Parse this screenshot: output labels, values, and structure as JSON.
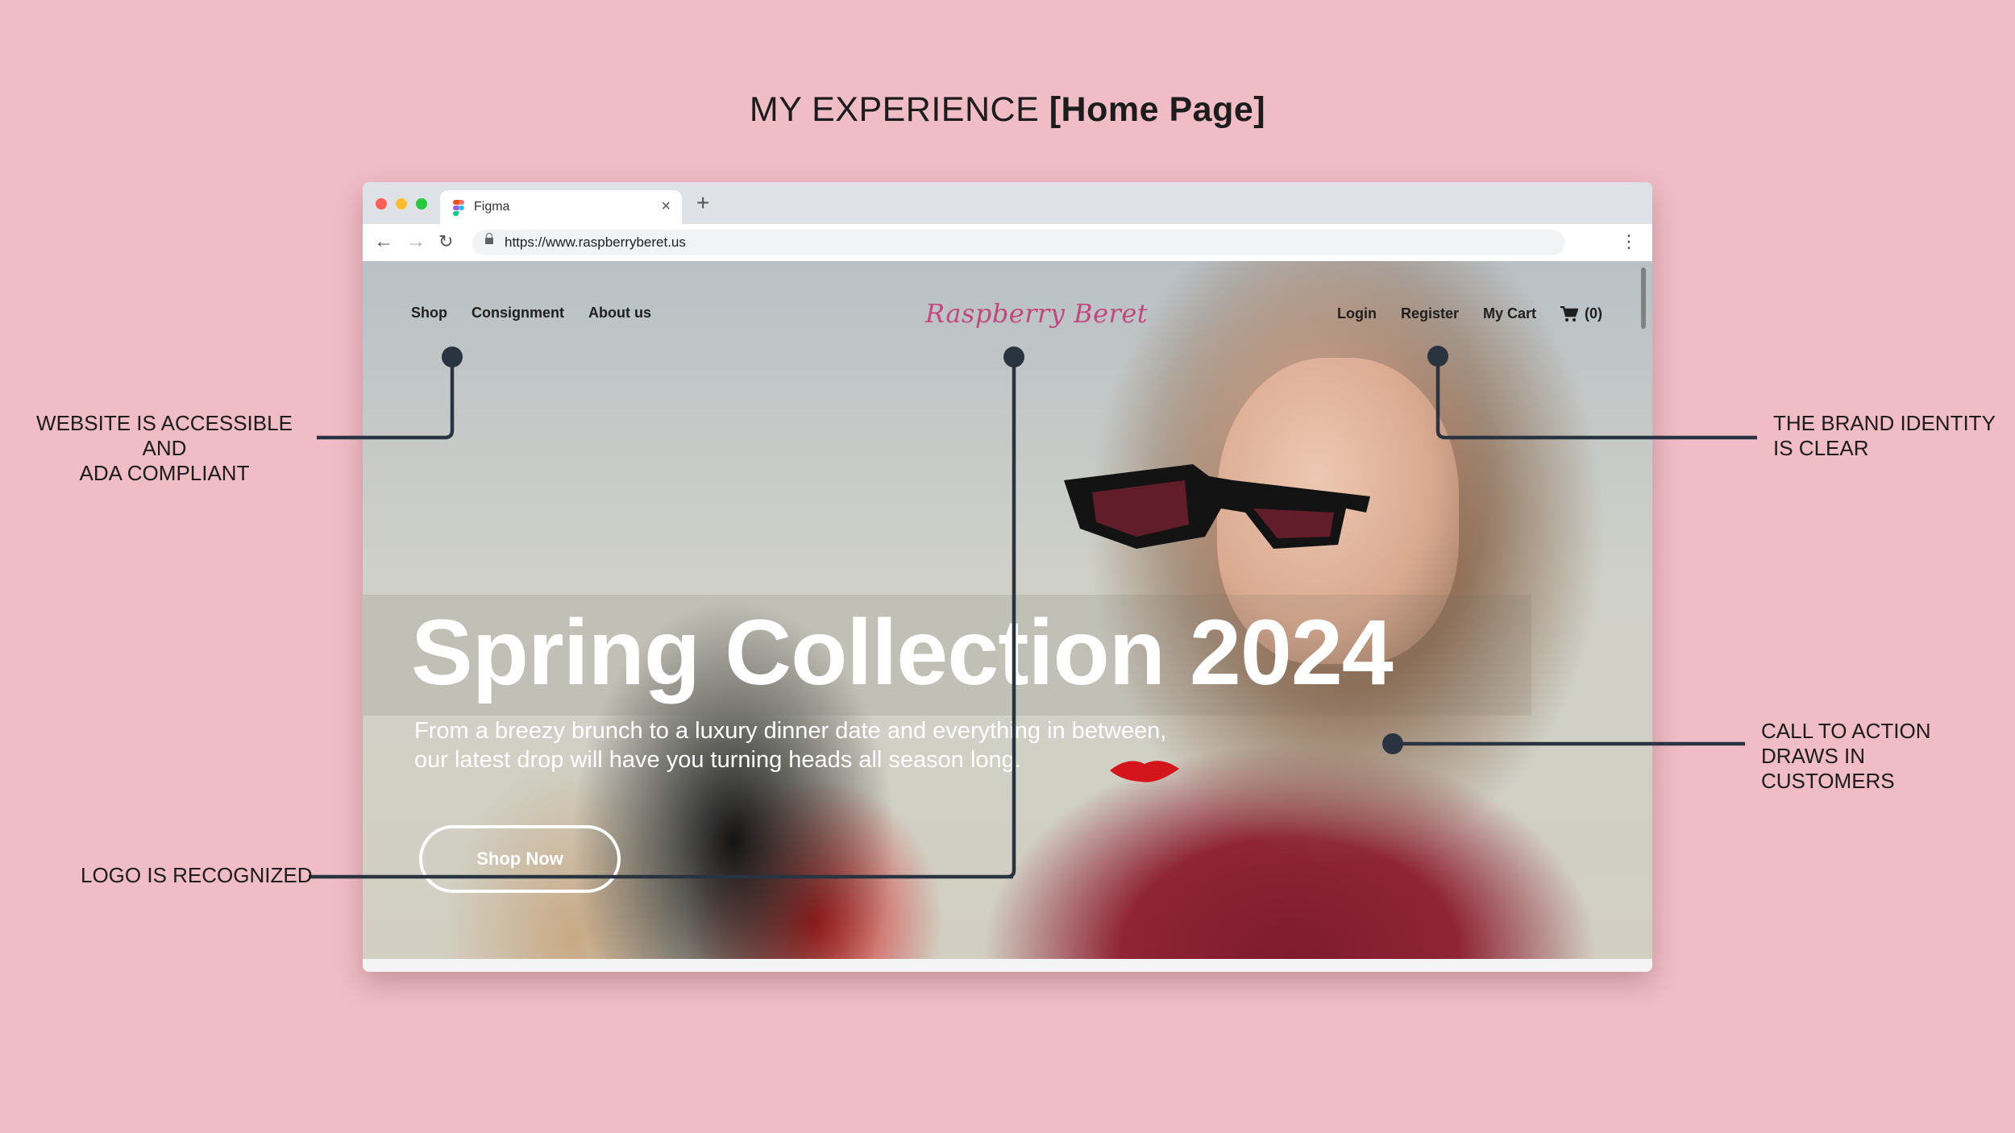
{
  "slide": {
    "title_regular": "MY EXPERIENCE",
    "title_bold": "[Home Page]"
  },
  "browser": {
    "tab_title": "Figma",
    "tab_close": "×",
    "new_tab": "+",
    "url": "https://www.raspberryberet.us",
    "back": "←",
    "forward": "→",
    "reload": "↻",
    "menu": "⋮"
  },
  "site": {
    "nav_left": [
      "Shop",
      "Consignment",
      "About us"
    ],
    "logo": "Raspberry Beret",
    "nav_right": [
      "Login",
      "Register",
      "My Cart"
    ],
    "cart_count": "(0)",
    "hero_title": "Spring Collection 2024",
    "hero_subtitle": "From a breezy brunch to a luxury dinner date and everything in between, our latest drop will have you turning heads all season long.",
    "cta_label": "Shop Now"
  },
  "callouts": {
    "accessible": [
      "WEBSITE IS ACCESSIBLE AND",
      "ADA COMPLIANT"
    ],
    "brand": [
      "THE BRAND IDENTITY",
      "IS CLEAR"
    ],
    "cta": [
      "CALL TO ACTION",
      "DRAWS IN CUSTOMERS"
    ],
    "logo": [
      "LOGO IS RECOGNIZED"
    ]
  },
  "colors": {
    "background": "#f0bcc5",
    "brand_pink": "#c2477f",
    "callout_line": "#2a3340"
  }
}
